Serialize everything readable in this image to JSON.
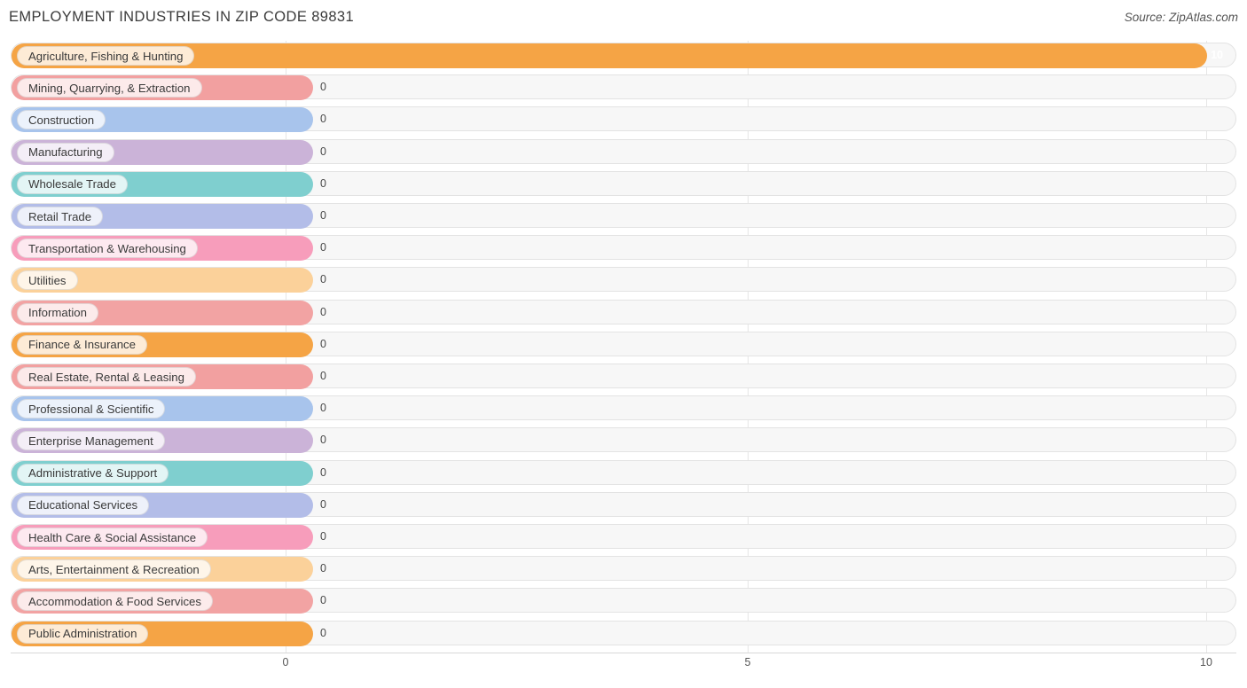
{
  "header": {
    "title": "EMPLOYMENT INDUSTRIES IN ZIP CODE 89831",
    "source": "Source: ZipAtlas.com"
  },
  "axis": {
    "ticks": [
      "0",
      "5",
      "10"
    ]
  },
  "chart_data": {
    "type": "bar",
    "orientation": "horizontal",
    "title": "EMPLOYMENT INDUSTRIES IN ZIP CODE 89831",
    "xlabel": "",
    "ylabel": "",
    "xlim": [
      0,
      10
    ],
    "xticks": [
      0,
      5,
      10
    ],
    "grid": true,
    "legend": "none",
    "categories": [
      "Agriculture, Fishing & Hunting",
      "Mining, Quarrying, & Extraction",
      "Construction",
      "Manufacturing",
      "Wholesale Trade",
      "Retail Trade",
      "Transportation & Warehousing",
      "Utilities",
      "Information",
      "Finance & Insurance",
      "Real Estate, Rental & Leasing",
      "Professional & Scientific",
      "Enterprise Management",
      "Administrative & Support",
      "Educational Services",
      "Health Care & Social Assistance",
      "Arts, Entertainment & Recreation",
      "Accommodation & Food Services",
      "Public Administration"
    ],
    "values": [
      10,
      0,
      0,
      0,
      0,
      0,
      0,
      0,
      0,
      0,
      0,
      0,
      0,
      0,
      0,
      0,
      0,
      0,
      0
    ],
    "value_labels": [
      "10",
      "0",
      "0",
      "0",
      "0",
      "0",
      "0",
      "0",
      "0",
      "0",
      "0",
      "0",
      "0",
      "0",
      "0",
      "0",
      "0",
      "0",
      "0"
    ],
    "bar_colors": [
      "#f5a council",
      "#f2a0a0",
      "#a8c4ec",
      "#cbb3d8",
      "#7fcfcf",
      "#b3bde8",
      "#f79dbb",
      "#fbd19a",
      "#f2a3a3",
      "#a9c6ec",
      "#cdb2d6",
      "#7ecfce",
      "#b4bfe9",
      "#f79dbb",
      "#fbd2a0",
      "#f2a5a5",
      "#acc7ed",
      "#cbb4d9",
      "#7ed0cf"
    ]
  },
  "colors": {
    "row_bg": "#f7f7f7",
    "row_border": "#e3e3e3",
    "grid": "#e6e6e6",
    "accent_orange": "#f5a445"
  }
}
